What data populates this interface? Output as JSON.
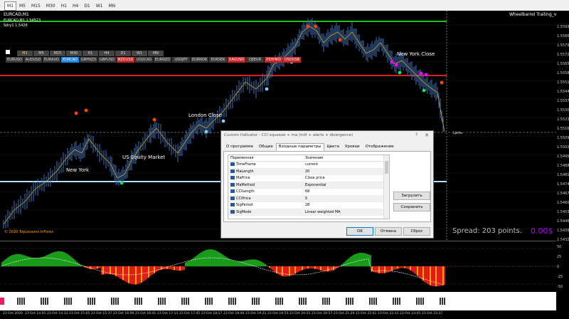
{
  "toolbar": {
    "timeframes": [
      "M1",
      "M5",
      "M15",
      "M30",
      "H1",
      "H4",
      "D1",
      "W1",
      "MN"
    ],
    "active": "M1"
  },
  "chart": {
    "symbol": "EURCAD,M1",
    "info_lines": [
      "EURCAD,M1 1.54523",
      "Sdry1 1.5426"
    ],
    "indicator_title": "Wheelbarrel Trailing_v1.2",
    "copyright": "© 2020 TopLessons InForex",
    "spread_text": "Spread: 203 points.",
    "profit_text": "0.00$",
    "price_line_label": "Цепь",
    "session_labels": [
      {
        "name": "new-york-label",
        "text": "New York"
      },
      {
        "name": "us-equity-label",
        "text": "US Equity Market"
      },
      {
        "name": "london-close-label",
        "text": "London Close"
      },
      {
        "name": "new-york-close-label",
        "text": "New York Close"
      }
    ],
    "mtf_buttons": [
      "M1",
      "M5",
      "M15",
      "M30",
      "H1",
      "H4",
      "D1",
      "W1",
      "MN"
    ],
    "mtf_active": "M1",
    "pair_buttons": [
      {
        "label": "EURUSD",
        "state": "normal"
      },
      {
        "label": "AUDUSD",
        "state": "normal"
      },
      {
        "label": "EURAUD",
        "state": "normal"
      },
      {
        "label": "EURCAD",
        "state": "current"
      },
      {
        "label": "GBPNZD",
        "state": "normal"
      },
      {
        "label": "GBPUSD",
        "state": "normal"
      },
      {
        "label": "NZDUSD",
        "state": "red"
      },
      {
        "label": "USDCAD",
        "state": "normal"
      },
      {
        "label": "EURNZD",
        "state": "normal"
      },
      {
        "label": "USDJPY",
        "state": "normal"
      },
      {
        "label": "EURNOK",
        "state": "normal"
      },
      {
        "label": "EURSEK",
        "state": "normal"
      },
      {
        "label": "XAUUSD",
        "state": "red"
      },
      {
        "label": "DJIEUR",
        "state": "normal"
      },
      {
        "label": "XSHHKD",
        "state": "red"
      },
      {
        "label": "USDUSB",
        "state": "red"
      }
    ],
    "price_ticks": [
      "1.55930",
      "1.55860",
      "1.55790",
      "1.55720",
      "1.55650",
      "1.55585",
      "1.55515",
      "1.55445",
      "1.55375",
      "1.55305",
      "1.55235",
      "1.55165",
      "1.55095",
      "1.55025",
      "1.54955",
      "1.54885",
      "1.54815",
      "1.54745",
      "1.54675",
      "1.54605",
      "1.54535",
      "1.54465",
      "1.54395",
      "1.54325"
    ],
    "colors": {
      "green_level": "#1fbf1f",
      "red_level": "#e01b1b",
      "blue_level": "#aee3ff",
      "candle": "#3f6fb8",
      "up": "#1a9c1a",
      "down": "#e01b1b"
    }
  },
  "subwindow": {
    "ticks": [
      "50",
      "25",
      "0",
      "-25",
      "-50"
    ]
  },
  "time_axis": [
    "23 Oct 2020",
    "23 Oct 14:05",
    "23 Oct 14:33",
    "23 Oct 15:05",
    "23 Oct 15:37",
    "23 Oct 16:09",
    "23 Oct 16:41",
    "23 Oct 17:13",
    "23 Oct 17:45",
    "23 Oct 18:17",
    "23 Oct 18:49",
    "23 Oct 19:21",
    "23 Oct 19:53",
    "23 Oct 20:25",
    "23 Oct 20:57",
    "23 Oct 21:29",
    "23 Oct 22:01",
    "23 Oct 22:33",
    "23 Oct 23:05",
    "23 Oct 23:37"
  ],
  "dialog": {
    "title": "Custom Indicator - CCI squeeze + ma (mtf + alerts + divergence)",
    "help": "?",
    "close": "✕",
    "tabs": [
      "О программе",
      "Общие",
      "Входные параметры",
      "Цвета",
      "Уровни",
      "Отображение"
    ],
    "active_tab": "Входные параметры",
    "col_variable": "Переменная",
    "col_value": "Значение",
    "params": [
      {
        "name": "TimeFrame",
        "value": "current"
      },
      {
        "name": "MaLength",
        "value": "20"
      },
      {
        "name": "MaPrice",
        "value": "Close price"
      },
      {
        "name": "MaMethod",
        "value": "Exponential"
      },
      {
        "name": "CCILength",
        "value": "68"
      },
      {
        "name": "CCIPrice",
        "value": "5"
      },
      {
        "name": "SigPeriod",
        "value": "28"
      },
      {
        "name": "SigMode",
        "value": "Linear weighted MA"
      }
    ],
    "load_label": "Загрузить",
    "save_label": "Сохранить",
    "ok_label": "OK",
    "cancel_label": "Отмена",
    "reset_label": "Сброс"
  }
}
